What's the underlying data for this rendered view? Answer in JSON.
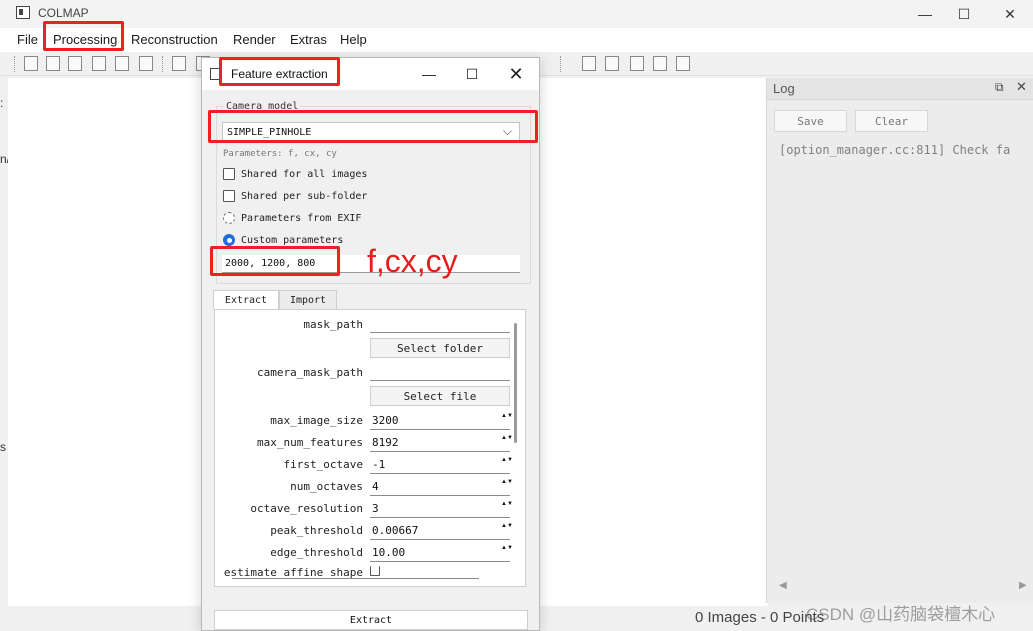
{
  "app": {
    "title": "COLMAP",
    "min_icon": "—",
    "max_icon": "☐",
    "close_icon": "✕"
  },
  "menubar": {
    "items": [
      "File",
      "Processing",
      "Reconstruction",
      "Render",
      "Extras",
      "Help"
    ]
  },
  "left_edge": {
    "glyphs": [
      ":",
      "n/",
      "s"
    ]
  },
  "log": {
    "title": "Log",
    "float_icon": "⧉",
    "close_icon": "✕",
    "save_label": "Save",
    "clear_label": "Clear",
    "text": "[option_manager.cc:811] Check fa",
    "scroll_left": "◀",
    "scroll_right": "▶"
  },
  "status": {
    "text": "0 Images - 0 Points"
  },
  "watermark": "CSDN @山药脑袋檀木心",
  "dialog": {
    "title": "Feature extraction",
    "min_icon": "—",
    "max_icon": "☐",
    "close_icon": "✕",
    "camera_model_label": "Camera model",
    "camera_model_value": "SIMPLE_PINHOLE",
    "chevron": "⌵",
    "params_hint": "Parameters: f, cx, cy",
    "options": {
      "shared_all": "Shared for all images",
      "shared_sub": "Shared per sub-folder",
      "exif": "Parameters from EXIF",
      "custom": "Custom parameters"
    },
    "custom_params_value": "2000, 1200, 800",
    "tabs": [
      "Extract",
      "Import"
    ],
    "fields": {
      "mask_path": {
        "label": "mask_path",
        "button": "Select folder"
      },
      "camera_mask_path": {
        "label": "camera_mask_path",
        "button": "Select file"
      },
      "max_image_size": {
        "label": "max_image_size",
        "value": "3200"
      },
      "max_num_features": {
        "label": "max_num_features",
        "value": "8192"
      },
      "first_octave": {
        "label": "first_octave",
        "value": "-1"
      },
      "num_octaves": {
        "label": "num_octaves",
        "value": "4"
      },
      "octave_resolution": {
        "label": "octave_resolution",
        "value": "3"
      },
      "peak_threshold": {
        "label": "peak_threshold",
        "value": "0.00667"
      },
      "edge_threshold": {
        "label": "edge_threshold",
        "value": "10.00"
      },
      "estimate_affine_shape": {
        "label": "estimate affine shape"
      }
    },
    "spin_arrows": "▲▼",
    "extract_button": "Extract"
  },
  "annotation": {
    "note": "f,cx,cy",
    "color": "#f02020"
  }
}
